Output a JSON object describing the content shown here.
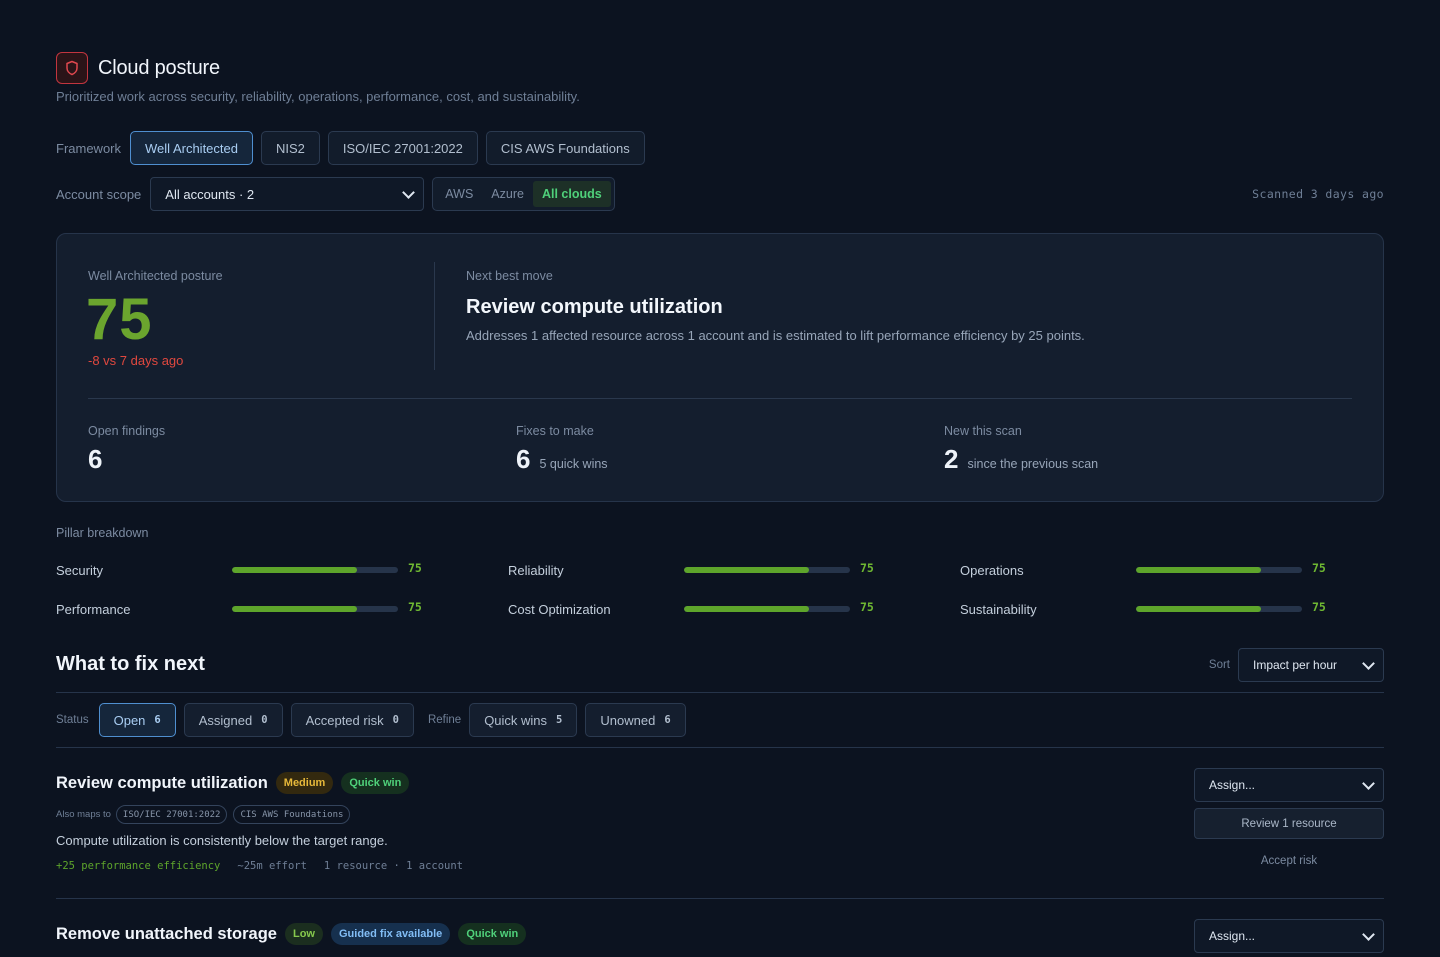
{
  "header": {
    "title": "Cloud posture",
    "subtitle": "Prioritized work across security, reliability, operations, performance, cost, and sustainability."
  },
  "framework": {
    "label": "Framework",
    "options": [
      "Well Architected",
      "NIS2",
      "ISO/IEC 27001:2022",
      "CIS AWS Foundations"
    ],
    "selected": "Well Architected"
  },
  "scope": {
    "label": "Account scope",
    "select_value": "All accounts · 2",
    "clouds": [
      "AWS",
      "Azure",
      "All clouds"
    ],
    "selected_cloud": "All clouds",
    "scanned": "Scanned 3 days ago"
  },
  "posture": {
    "label": "Well Architected posture",
    "score": "75",
    "delta": "-8 vs 7 days ago",
    "next_label": "Next best move",
    "next_title": "Review compute utilization",
    "next_desc": "Addresses 1 affected resource across 1 account and is estimated to lift performance efficiency by 25 points.",
    "stats": [
      {
        "label": "Open findings",
        "value": "6",
        "sub": ""
      },
      {
        "label": "Fixes to make",
        "value": "6",
        "sub": "5 quick wins"
      },
      {
        "label": "New this scan",
        "value": "2",
        "sub": "since the previous scan"
      }
    ]
  },
  "pillars": {
    "title": "Pillar breakdown",
    "items": [
      {
        "name": "Security",
        "score": "75",
        "fill": 0.75
      },
      {
        "name": "Reliability",
        "score": "75",
        "fill": 0.75
      },
      {
        "name": "Operations",
        "score": "75",
        "fill": 0.75
      },
      {
        "name": "Performance",
        "score": "75",
        "fill": 0.75
      },
      {
        "name": "Cost Optimization",
        "score": "75",
        "fill": 0.75
      },
      {
        "name": "Sustainability",
        "score": "75",
        "fill": 0.75
      }
    ]
  },
  "fix_next": {
    "title": "What to fix next",
    "sort_label": "Sort",
    "sort_value": "Impact per hour",
    "status_label": "Status",
    "refine_label": "Refine",
    "status_filters": [
      {
        "label": "Open",
        "count": "6"
      },
      {
        "label": "Assigned",
        "count": "0"
      },
      {
        "label": "Accepted risk",
        "count": "0"
      }
    ],
    "refine_filters": [
      {
        "label": "Quick wins",
        "count": "5"
      },
      {
        "label": "Unowned",
        "count": "6"
      }
    ]
  },
  "findings": [
    {
      "title": "Review compute utilization",
      "badges": [
        "Medium",
        "Quick win"
      ],
      "maps_label": "Also maps to",
      "maps": [
        "ISO/IEC 27001:2022",
        "CIS AWS Foundations"
      ],
      "desc": "Compute utilization is consistently below the target range.",
      "impact": "+25 performance efficiency",
      "effort": "~25m effort",
      "scope": "1 resource · 1 account",
      "assign": "Assign...",
      "review": "Review 1 resource",
      "accept": "Accept risk"
    },
    {
      "title": "Remove unattached storage",
      "badges": [
        "Low",
        "Guided fix available",
        "Quick win"
      ],
      "assign": "Assign..."
    }
  ],
  "colors": {
    "background": "#0c1320",
    "card": "#141e2e",
    "accent_blue": "#4f8fd0",
    "score_green": "#6ba52e",
    "delta_red": "#e0483f",
    "quick_win_green": "#4fd07a",
    "medium_amber": "#e7b93a"
  },
  "icons": {
    "logo": "shield-icon",
    "select": "chevron-down-icon"
  }
}
